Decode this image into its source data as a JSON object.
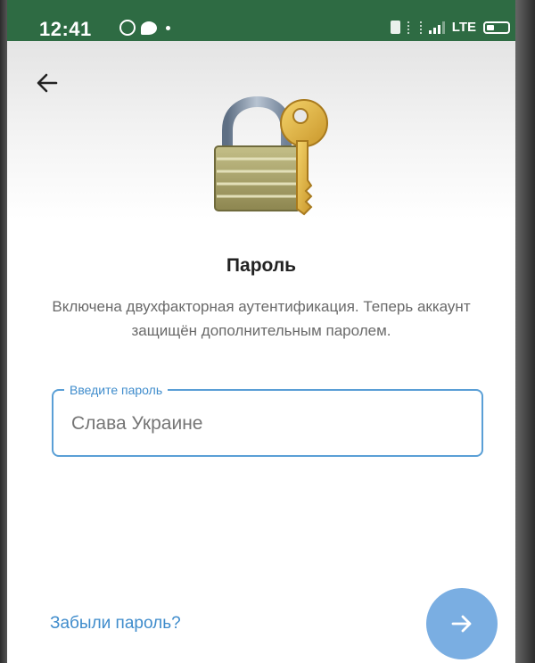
{
  "status_bar": {
    "time": "12:41",
    "network": "LTE",
    "background_color": "#2e6b43"
  },
  "header": {
    "back_icon": "arrow-left-icon",
    "illustration": "padlock-with-key-icon"
  },
  "main": {
    "title": "Пароль",
    "description": "Включена двухфакторная аутентификация. Теперь аккаунт защищён дополнительным паролем.",
    "password_field": {
      "label": "Введите пароль",
      "placeholder": "Слава Украине"
    },
    "forgot_password_label": "Забыли пароль?",
    "next_icon": "arrow-right-icon"
  },
  "colors": {
    "accent": "#3f8ccc",
    "field_border": "#5a9fd6",
    "fab": "#7aaee2"
  }
}
